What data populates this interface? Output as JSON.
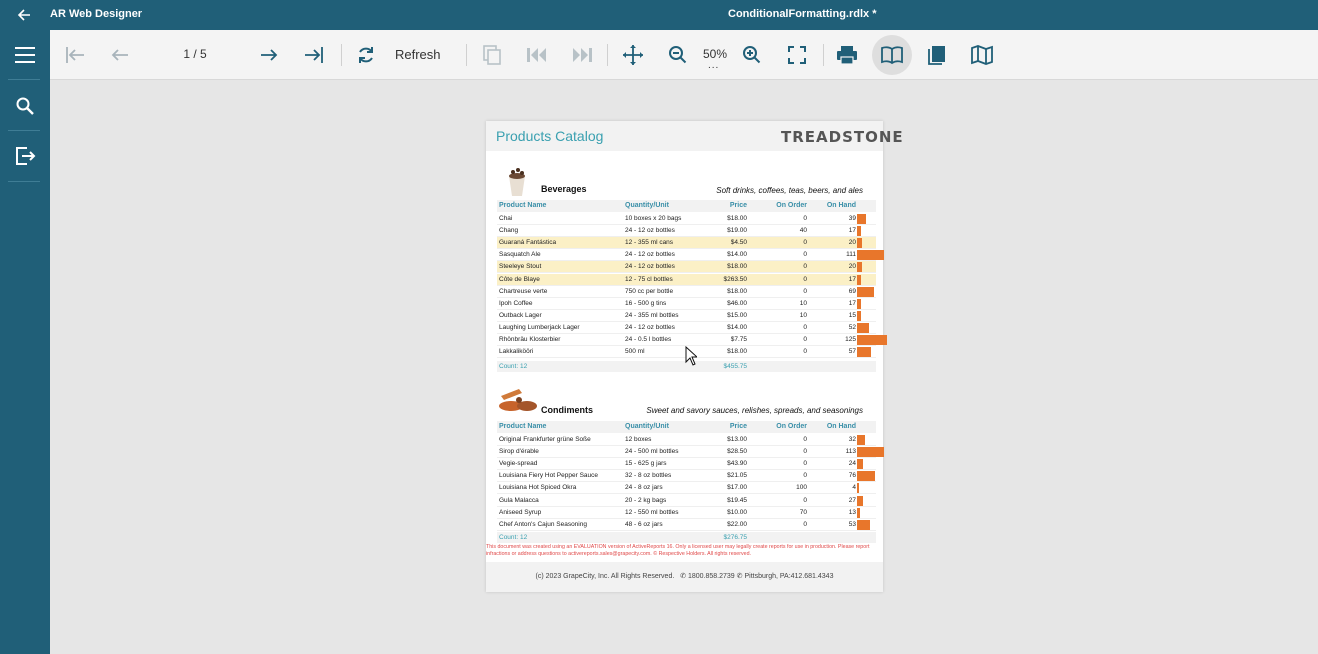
{
  "titlebar": {
    "app_title": "AR Web Designer",
    "document_title": "ConditionalFormatting.rdlx *"
  },
  "toolbar": {
    "page_indicator": "1 / 5",
    "refresh_label": "Refresh",
    "zoom_level": "50%",
    "zoom_more": "..."
  },
  "report": {
    "title": "Products Catalog",
    "logo_text": "TREADSTONE",
    "column_headers": {
      "name": "Product Name",
      "qty": "Quantity/Unit",
      "price": "Price",
      "order": "On Order",
      "hand": "On Hand"
    },
    "categories": [
      {
        "name": "Beverages",
        "description": "Soft drinks, coffees, teas, beers, and ales",
        "rows": [
          {
            "name": "Chai",
            "qty": "10 boxes x 20 bags",
            "price": "$18.00",
            "order": "0",
            "hand": "39",
            "hand_value": 39,
            "highlight": false
          },
          {
            "name": "Chang",
            "qty": "24 - 12 oz bottles",
            "price": "$19.00",
            "order": "40",
            "hand": "17",
            "hand_value": 17,
            "highlight": false
          },
          {
            "name": "Guaraná Fantástica",
            "qty": "12 - 355 ml cans",
            "price": "$4.50",
            "order": "0",
            "hand": "20",
            "hand_value": 20,
            "highlight": true
          },
          {
            "name": "Sasquatch Ale",
            "qty": "24 - 12 oz bottles",
            "price": "$14.00",
            "order": "0",
            "hand": "111",
            "hand_value": 111,
            "highlight": false
          },
          {
            "name": "Steeleye Stout",
            "qty": "24 - 12 oz bottles",
            "price": "$18.00",
            "order": "0",
            "hand": "20",
            "hand_value": 20,
            "highlight": true
          },
          {
            "name": "Côte de Blaye",
            "qty": "12 - 75 cl bottles",
            "price": "$263.50",
            "order": "0",
            "hand": "17",
            "hand_value": 17,
            "highlight": true
          },
          {
            "name": "Chartreuse verte",
            "qty": "750 cc per bottle",
            "price": "$18.00",
            "order": "0",
            "hand": "69",
            "hand_value": 69,
            "highlight": false
          },
          {
            "name": "Ipoh Coffee",
            "qty": "16 - 500 g tins",
            "price": "$46.00",
            "order": "10",
            "hand": "17",
            "hand_value": 17,
            "highlight": false
          },
          {
            "name": "Outback Lager",
            "qty": "24 - 355 ml bottles",
            "price": "$15.00",
            "order": "10",
            "hand": "15",
            "hand_value": 15,
            "highlight": false
          },
          {
            "name": "Laughing Lumberjack Lager",
            "qty": "24 - 12 oz bottles",
            "price": "$14.00",
            "order": "0",
            "hand": "52",
            "hand_value": 52,
            "highlight": false
          },
          {
            "name": "Rhönbräu Klosterbier",
            "qty": "24 - 0.5 l bottles",
            "price": "$7.75",
            "order": "0",
            "hand": "125",
            "hand_value": 125,
            "highlight": false
          },
          {
            "name": "Lakkalikööri",
            "qty": "500 ml",
            "price": "$18.00",
            "order": "0",
            "hand": "57",
            "hand_value": 57,
            "highlight": false
          }
        ],
        "count_label": "Count: 12",
        "total": "$455.75"
      },
      {
        "name": "Condiments",
        "description": "Sweet and savory sauces, relishes, spreads, and seasonings",
        "rows": [
          {
            "name": "Original Frankfurter grüne Soße",
            "qty": "12 boxes",
            "price": "$13.00",
            "order": "0",
            "hand": "32",
            "hand_value": 32,
            "highlight": false
          },
          {
            "name": "Sirop d'érable",
            "qty": "24 - 500 ml bottles",
            "price": "$28.50",
            "order": "0",
            "hand": "113",
            "hand_value": 113,
            "highlight": false
          },
          {
            "name": "Vegie-spread",
            "qty": "15 - 625 g jars",
            "price": "$43.90",
            "order": "0",
            "hand": "24",
            "hand_value": 24,
            "highlight": false
          },
          {
            "name": "Louisiana Fiery Hot Pepper Sauce",
            "qty": "32 - 8 oz bottles",
            "price": "$21.05",
            "order": "0",
            "hand": "76",
            "hand_value": 76,
            "highlight": false
          },
          {
            "name": "Louisiana Hot Spiced Okra",
            "qty": "24 - 8 oz jars",
            "price": "$17.00",
            "order": "100",
            "hand": "4",
            "hand_value": 4,
            "highlight": false
          },
          {
            "name": "Gula Malacca",
            "qty": "20 - 2 kg bags",
            "price": "$19.45",
            "order": "0",
            "hand": "27",
            "hand_value": 27,
            "highlight": false
          },
          {
            "name": "Aniseed Syrup",
            "qty": "12 - 550 ml bottles",
            "price": "$10.00",
            "order": "70",
            "hand": "13",
            "hand_value": 13,
            "highlight": false
          },
          {
            "name": "Chef Anton's Cajun Seasoning",
            "qty": "48 - 6 oz jars",
            "price": "$22.00",
            "order": "0",
            "hand": "53",
            "hand_value": 53,
            "highlight": false
          }
        ],
        "count_label": "Count: 12",
        "total": "$276.75"
      }
    ],
    "evaluation_notice": "This document was created using an EVALUATION version of ActiveReports 16. Only a licensed user may legally create reports for use in production. Please report infractions or address questions to activereports.sales@grapecity.com. © Respective Holders. All rights reserved.",
    "footer_text": "(c) 2023 GrapeCity, Inc. All Rights Reserved.",
    "footer_phone": "1800.858.2739",
    "footer_location": "Pittsburgh, PA:412.681.4343"
  },
  "colors": {
    "brand": "#205f78",
    "accent": "#3aa0b0",
    "bar": "#e8762b",
    "highlight": "#fbf0c6"
  }
}
